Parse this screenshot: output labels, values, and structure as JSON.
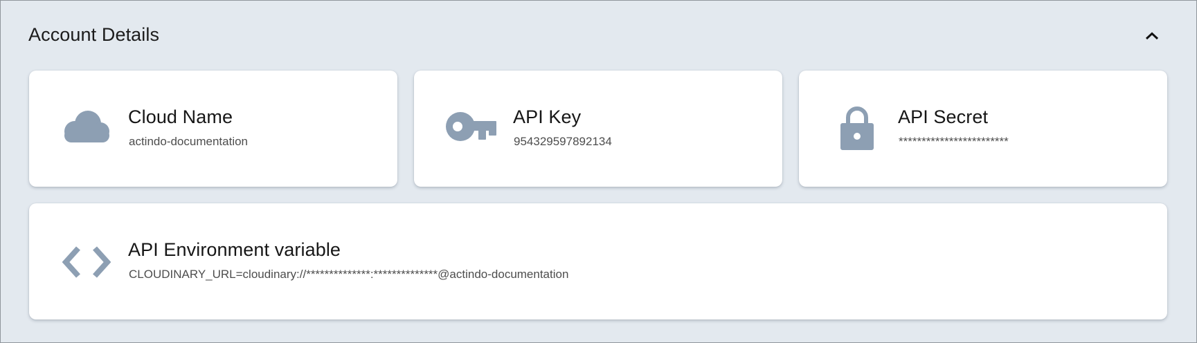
{
  "section": {
    "title": "Account Details",
    "toggle_icon": "chevron-up-icon"
  },
  "cards": {
    "cloud_name": {
      "icon": "cloud-icon",
      "title": "Cloud Name",
      "value": "actindo-documentation"
    },
    "api_key": {
      "icon": "key-icon",
      "title": "API Key",
      "value": "954329597892134"
    },
    "api_secret": {
      "icon": "lock-icon",
      "title": "API Secret",
      "value": "************************"
    },
    "env_variable": {
      "icon": "code-icon",
      "title": "API Environment variable",
      "value": "CLOUDINARY_URL=cloudinary://**************:**************@actindo-documentation"
    }
  },
  "colors": {
    "background": "#e3e9ef",
    "card_background": "#ffffff",
    "icon": "#8d9fb3",
    "title_text": "#161616",
    "value_text": "#4d4d4d"
  }
}
